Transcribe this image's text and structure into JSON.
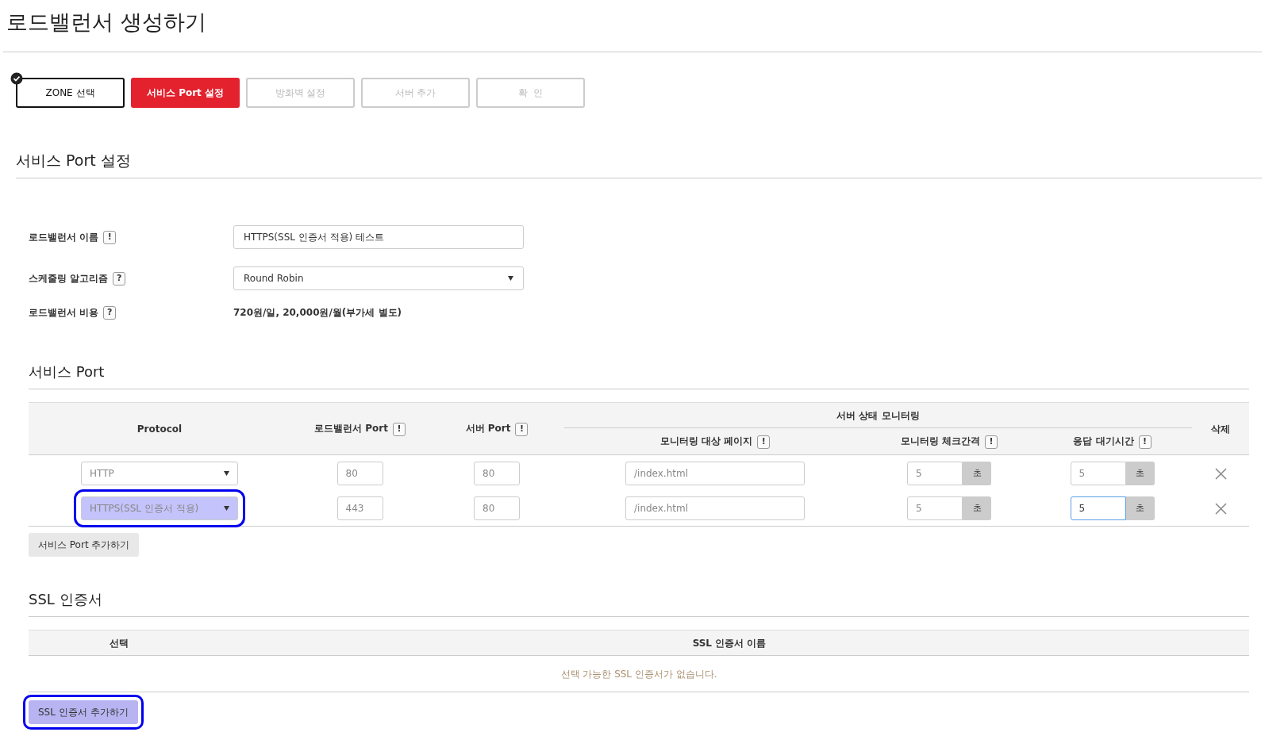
{
  "page_title": "로드밸런서 생성하기",
  "steps": [
    {
      "label": "ZONE 선택",
      "kind": "done"
    },
    {
      "label": "서비스 Port 설정",
      "kind": "active"
    },
    {
      "label": "방화벽 설정",
      "kind": "pending"
    },
    {
      "label": "서버 추가",
      "kind": "pending"
    },
    {
      "label": "확  인",
      "kind": "pending"
    }
  ],
  "section_title": "서비스 Port 설정",
  "form": [
    {
      "label": "로드밸런서 이름",
      "hint": "!",
      "kind": "input",
      "value": "HTTPS(SSL 인증서 적용) 테스트"
    },
    {
      "label": "스케줄링 알고리즘",
      "hint": "?",
      "kind": "select",
      "value": "Round Robin"
    },
    {
      "label": "로드밸런서 비용",
      "hint": "?",
      "kind": "text",
      "value": "720원/일, 20,000원/월(부가세 별도)"
    }
  ],
  "service_port": {
    "title": "서비스 Port",
    "columns": {
      "protocol": "Protocol",
      "lb_port": "로드밸런서 Port",
      "lb_port_hint": "!",
      "server_port": "서버 Port",
      "server_port_hint": "!",
      "monitoring": "서버 상태 모니터링",
      "page": "모니터링 대상 페이지",
      "page_hint": "!",
      "interval": "모니터링 체크간격",
      "interval_hint": "!",
      "timeout": "응답 대기시간",
      "timeout_hint": "!",
      "delete": "삭제"
    },
    "rows": [
      {
        "protocol": "HTTP",
        "protocol_highlighted": false,
        "lb_port": "80",
        "server_port": "80",
        "page": "/index.html",
        "interval": "5",
        "interval_unit": "초",
        "timeout": "5",
        "timeout_unit": "초",
        "timeout_focused": false
      },
      {
        "protocol": "HTTPS(SSL 인증서 적용)",
        "protocol_highlighted": true,
        "lb_port": "443",
        "server_port": "80",
        "page": "/index.html",
        "interval": "5",
        "interval_unit": "초",
        "timeout": "5",
        "timeout_unit": "초",
        "timeout_focused": true
      }
    ],
    "add_button": {
      "label": "서비스 Port 추가하기",
      "highlighted": false
    }
  },
  "ssl": {
    "title": "SSL 인증서",
    "columns": [
      "선택",
      "SSL 인증서 이름"
    ],
    "empty_message": "선택 가능한 SSL 인증서가 없습니다.",
    "add_button": {
      "label": "SSL 인증서 추가하기",
      "highlighted": true
    }
  }
}
